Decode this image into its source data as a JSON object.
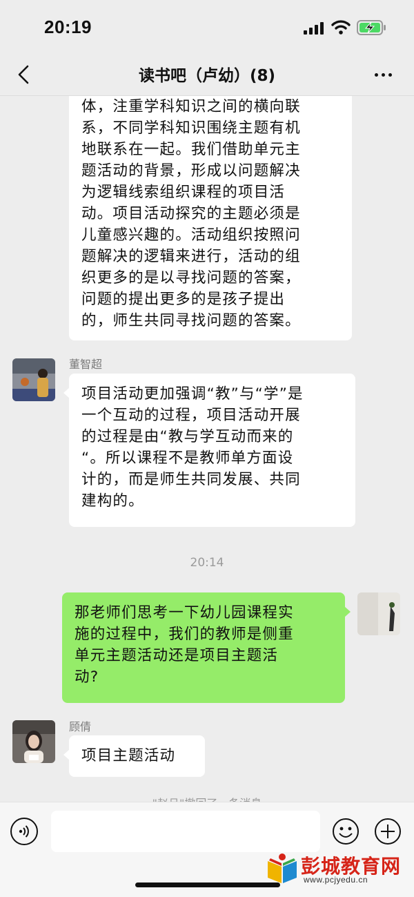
{
  "status_bar": {
    "time": "20:19"
  },
  "header": {
    "title": "读书吧（卢幼）(8)"
  },
  "messages": [
    {
      "type": "incoming",
      "text": "体，注重学科知识之间的横向联\n系，不同学科知识围绕主题有机\n地联系在一起。我们借助单元主\n题活动的背景，形成以问题解决\n为逻辑线索组织课程的项目活\n动。项目活动探究的主题必须是\n儿童感兴趣的。活动组织按照问\n题解决的逻辑来进行，活动的组\n织更多的是以寻找问题的答案，\n问题的提出更多的是孩子提出\n的，师生共同寻找问题的答案。"
    },
    {
      "type": "incoming",
      "sender": "董智超",
      "text": "项目活动更加强调“教”与“学”是\n一个互动的过程，项目活动开展\n的过程是由“教与学互动而来的\n“。所以课程不是教师单方面设\n计的，而是师生共同发展、共同\n建构的。"
    },
    {
      "type": "timestamp",
      "text": "20:14"
    },
    {
      "type": "outgoing",
      "text": "那老师们思考一下幼儿园课程实\n施的过程中，我们的教师是侧重\n单元主题活动还是项目主题活\n动?"
    },
    {
      "type": "incoming",
      "sender": "顾倩",
      "text": "项目主题活动"
    },
    {
      "type": "system",
      "text": "\"赵旦\"撤回了一条消息"
    }
  ],
  "input_bar": {
    "placeholder": ""
  },
  "watermark": {
    "text": "彭城教育网",
    "url": "www.pcjyedu.cn"
  },
  "colors": {
    "background": "#ededed",
    "outgoing_bubble": "#95ec69",
    "incoming_bubble": "#ffffff",
    "watermark_red": "#d62418"
  }
}
